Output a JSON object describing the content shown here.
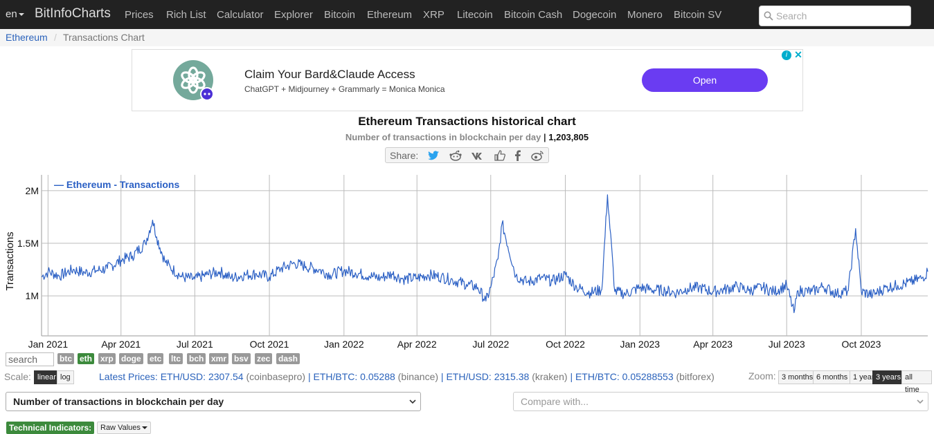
{
  "navbar": {
    "lang": "en",
    "brand": "BitInfoCharts",
    "links": [
      "Prices",
      "Rich List",
      "Calculator",
      "Explorer",
      "Bitcoin",
      "Ethereum",
      "XRP",
      "Litecoin",
      "Bitcoin Cash",
      "Dogecoin",
      "Monero",
      "Bitcoin SV"
    ],
    "search_placeholder": "Search"
  },
  "breadcrumb": {
    "parent": "Ethereum",
    "separator": "/",
    "current": "Transactions Chart"
  },
  "ad": {
    "title": "Claim Your Bard&Claude Access",
    "subtitle": "ChatGPT + Midjourney + Grammarly = Monica Monica",
    "button": "Open",
    "adchoice": "i",
    "close": "✕",
    "brand_color": "#6a3cf2"
  },
  "header": {
    "title": "Ethereum Transactions historical chart",
    "subtitle_label": "Number of transactions in blockchain per day",
    "subtitle_sep": "|",
    "subtitle_value": "1,203,805"
  },
  "share": {
    "label": "Share:",
    "icons": [
      "twitter-icon",
      "reddit-icon",
      "vk-icon",
      "like-icon",
      "facebook-icon",
      "weibo-icon"
    ]
  },
  "chart_data": {
    "type": "line",
    "legend": "— Ethereum - Transactions",
    "legend_placement": "top-left",
    "ylabel": "Transactions",
    "yticks": [
      "2M",
      "1.5M",
      "1M"
    ],
    "ytick_values": [
      2000000,
      1500000,
      1000000
    ],
    "ylim": [
      620000,
      2150000
    ],
    "xticks": [
      "Jan 2021",
      "Apr 2021",
      "Jul 2021",
      "Oct 2021",
      "Jan 2022",
      "Apr 2022",
      "Jul 2022",
      "Oct 2022",
      "Jan 2023",
      "Apr 2023",
      "Jul 2023",
      "Oct 2023"
    ],
    "xtick_dates": [
      "2021-01-01",
      "2021-04-01",
      "2021-07-01",
      "2021-10-01",
      "2022-01-01",
      "2022-04-01",
      "2022-07-01",
      "2022-10-01",
      "2023-01-01",
      "2023-04-01",
      "2023-07-01",
      "2023-10-01"
    ],
    "x_range": [
      "2020-12-24",
      "2023-12-22"
    ],
    "grid": true,
    "line_color": "#2a5fc4",
    "series": [
      {
        "name": "Ethereum - Transactions",
        "x": [
          "2020-12-24",
          "2021-01-01",
          "2021-01-15",
          "2021-02-01",
          "2021-02-15",
          "2021-03-01",
          "2021-03-15",
          "2021-04-01",
          "2021-04-15",
          "2021-05-01",
          "2021-05-10",
          "2021-05-15",
          "2021-05-25",
          "2021-06-01",
          "2021-06-15",
          "2021-07-01",
          "2021-07-15",
          "2021-08-01",
          "2021-08-15",
          "2021-09-01",
          "2021-09-15",
          "2021-10-01",
          "2021-10-15",
          "2021-11-01",
          "2021-11-15",
          "2021-12-01",
          "2021-12-15",
          "2022-01-01",
          "2022-01-15",
          "2022-02-01",
          "2022-02-15",
          "2022-03-01",
          "2022-03-15",
          "2022-04-01",
          "2022-04-15",
          "2022-05-01",
          "2022-05-15",
          "2022-06-01",
          "2022-06-15",
          "2022-06-25",
          "2022-07-01",
          "2022-07-10",
          "2022-07-15",
          "2022-08-01",
          "2022-08-15",
          "2022-09-01",
          "2022-09-15",
          "2022-10-01",
          "2022-10-15",
          "2022-11-01",
          "2022-11-15",
          "2022-11-22",
          "2022-12-01",
          "2022-12-15",
          "2023-01-01",
          "2023-01-15",
          "2023-02-01",
          "2023-02-15",
          "2023-03-01",
          "2023-03-15",
          "2023-04-01",
          "2023-04-15",
          "2023-05-01",
          "2023-05-15",
          "2023-06-01",
          "2023-06-15",
          "2023-07-01",
          "2023-07-10",
          "2023-07-15",
          "2023-08-01",
          "2023-08-15",
          "2023-09-01",
          "2023-09-15",
          "2023-09-24",
          "2023-10-01",
          "2023-10-15",
          "2023-11-01",
          "2023-11-15",
          "2023-12-01",
          "2023-12-15",
          "2023-12-22"
        ],
        "values": [
          1180000,
          1230000,
          1190000,
          1250000,
          1220000,
          1240000,
          1260000,
          1340000,
          1380000,
          1500000,
          1720000,
          1560000,
          1330000,
          1270000,
          1180000,
          1160000,
          1200000,
          1230000,
          1170000,
          1200000,
          1210000,
          1180000,
          1260000,
          1310000,
          1280000,
          1250000,
          1200000,
          1240000,
          1220000,
          1190000,
          1170000,
          1210000,
          1160000,
          1170000,
          1200000,
          1180000,
          1150000,
          1110000,
          1080000,
          950000,
          1080000,
          1350000,
          1690000,
          1190000,
          1130000,
          1170000,
          1140000,
          1200000,
          1080000,
          1030000,
          1060000,
          1960000,
          1040000,
          1020000,
          1080000,
          1060000,
          1050000,
          1030000,
          1070000,
          1080000,
          1040000,
          1060000,
          1090000,
          1050000,
          1080000,
          1040000,
          1100000,
          840000,
          1050000,
          1040000,
          1090000,
          1020000,
          1050000,
          1640000,
          1040000,
          1010000,
          1080000,
          1100000,
          1130000,
          1170000,
          1230000
        ]
      }
    ]
  },
  "coins": {
    "search_placeholder": "search",
    "list": [
      "btc",
      "eth",
      "xrp",
      "doge",
      "etc",
      "ltc",
      "bch",
      "xmr",
      "bsv",
      "zec",
      "dash"
    ],
    "active": "eth"
  },
  "scale": {
    "label": "Scale:",
    "linear": "linear",
    "log": "log",
    "active": "linear"
  },
  "prices": {
    "label": "Latest Prices:",
    "items": [
      {
        "pair": "ETH/USD:",
        "value": "2307.54",
        "exchange": "(coinbasepro)"
      },
      {
        "pair": "ETH/BTC:",
        "value": "0.05288",
        "exchange": "(binance)"
      },
      {
        "pair": "ETH/USD:",
        "value": "2315.38",
        "exchange": "(kraken)"
      },
      {
        "pair": "ETH/BTC:",
        "value": "0.05288553",
        "exchange": "(bitforex)"
      }
    ],
    "separator": "|"
  },
  "zoom": {
    "label": "Zoom:",
    "options": [
      "3 months",
      "6 months",
      "1 year",
      "3 years",
      "all time"
    ],
    "active": "3 years"
  },
  "selects": {
    "metric": "Number of transactions in blockchain per day",
    "compare_placeholder": "Compare with..."
  },
  "indicators": {
    "label": "Technical Indicators:",
    "raw": "Raw Values"
  }
}
